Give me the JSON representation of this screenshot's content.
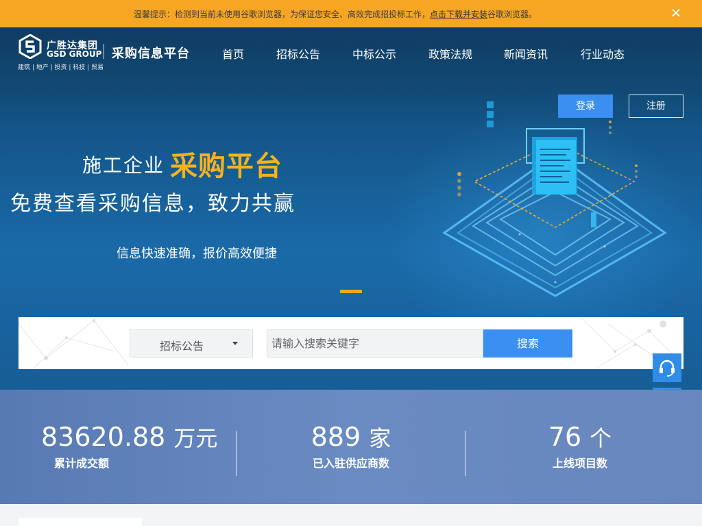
{
  "notice": {
    "text": "温馨提示：检测到当前未使用谷歌浏览器，为保证您安全、高效完成招投标工作，",
    "link": "点击下载并安装",
    "suffix": "谷歌浏览器。",
    "close": "✕"
  },
  "brand": {
    "name_cn": "广胜达集团",
    "name_en": "GSD GROUP",
    "business": "建筑 | 地产 | 投资 | 科技 | 贸易",
    "platform": "采购信息平台"
  },
  "nav": [
    "首页",
    "招标公告",
    "中标公示",
    "政策法规",
    "新闻资讯",
    "行业动态"
  ],
  "auth": {
    "login": "登录",
    "register": "注册"
  },
  "hero": {
    "line1": "施工企业",
    "line1_highlight": "采购平台",
    "line2": "免费查看采购信息，致力共赢",
    "line3": "信息快速准确，报价高效便捷"
  },
  "search": {
    "category": "招标公告",
    "placeholder": "请输入搜索关键字",
    "button": "搜索"
  },
  "stats": [
    {
      "value": "83620.88",
      "unit": "万元",
      "label": "累计成交额"
    },
    {
      "value": "889",
      "unit": "家",
      "label": "已入驻供应商数"
    },
    {
      "value": "76",
      "unit": "个",
      "label": "上线项目数"
    }
  ],
  "floaters": {
    "service": "headset-icon",
    "qrcode": "qrcode-icon"
  },
  "colors": {
    "notice_bg": "#f6a623",
    "accent_blue": "#3a8ff0",
    "highlight_gold": "#f5b21f",
    "stats_bg": "#6a8bc2"
  }
}
